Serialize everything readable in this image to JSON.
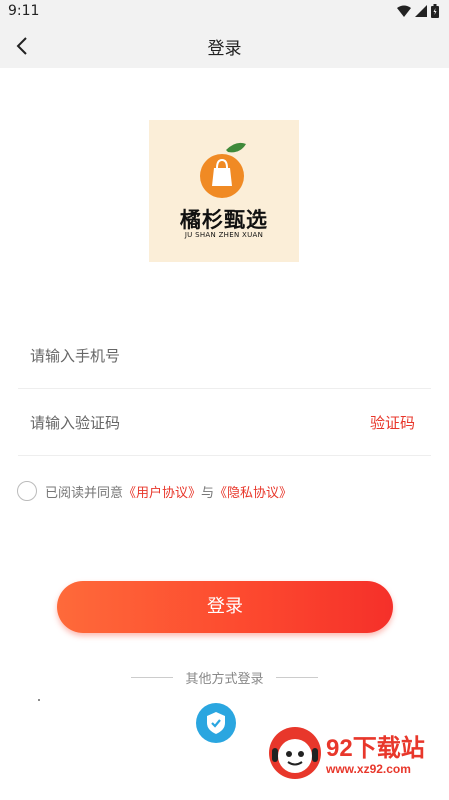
{
  "status": {
    "time": "9:11"
  },
  "nav": {
    "title": "登录"
  },
  "logo": {
    "brand": "橘杉甄选",
    "subtitle": "JU SHAN ZHEN XUAN"
  },
  "form": {
    "phone_placeholder": "请输入手机号",
    "code_placeholder": "请输入验证码",
    "code_button": "验证码"
  },
  "agreement": {
    "prefix": "已阅读并同意",
    "user_agreement": "《用户协议》",
    "joiner": "与",
    "privacy_policy": "《隐私协议》"
  },
  "login_button": "登录",
  "other_login": {
    "label": "其他方式登录",
    "icon": "shield-check-icon"
  },
  "watermark": {
    "title": "92下载站",
    "url": "www.xz92.com"
  },
  "colors": {
    "accent": "#e8372b",
    "button_start": "#fe6a3a",
    "button_end": "#f5302a",
    "shield": "#2aa6e0",
    "logo_bg": "#fbeed8"
  }
}
